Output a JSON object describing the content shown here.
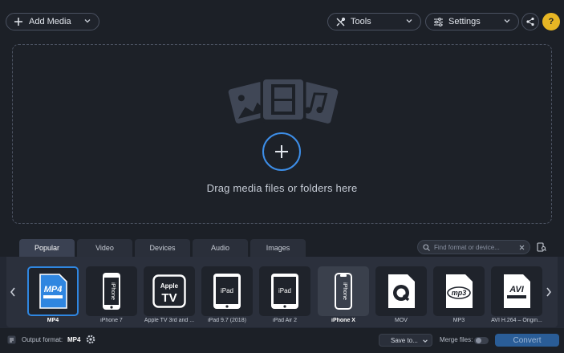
{
  "toolbar": {
    "add_media_label": "Add Media",
    "tools_label": "Tools",
    "settings_label": "Settings",
    "help_label": "?"
  },
  "dropzone": {
    "text": "Drag media files or folders here"
  },
  "tabs": [
    {
      "label": "Popular",
      "active": true
    },
    {
      "label": "Video",
      "active": false
    },
    {
      "label": "Devices",
      "active": false
    },
    {
      "label": "Audio",
      "active": false
    },
    {
      "label": "Images",
      "active": false
    }
  ],
  "search": {
    "placeholder": "Find format or device..."
  },
  "formats": [
    {
      "label": "MP4",
      "badge": "MP4",
      "selected": true
    },
    {
      "label": "iPhone 7",
      "badge": "iPhone"
    },
    {
      "label": "Apple TV 3rd and ...",
      "badge_top": "Apple",
      "badge_bottom": "TV"
    },
    {
      "label": "iPad 9.7 (2018)",
      "badge": "iPad"
    },
    {
      "label": "iPad Air 2",
      "badge": "iPad"
    },
    {
      "label": "iPhone X",
      "badge": "iPhone",
      "hover": true
    },
    {
      "label": "MOV",
      "badge": ""
    },
    {
      "label": "MP3",
      "badge": "mp3"
    },
    {
      "label": "AVI H.264 – Origin...",
      "badge": "AVI"
    }
  ],
  "status": {
    "output_format_label": "Output format:",
    "output_format_value": "MP4",
    "save_to_label": "Save to...",
    "merge_files_label": "Merge files:",
    "convert_label": "Convert"
  },
  "colors": {
    "accent": "#2f86e0",
    "background": "#1c2027",
    "panel": "#2b303c"
  }
}
